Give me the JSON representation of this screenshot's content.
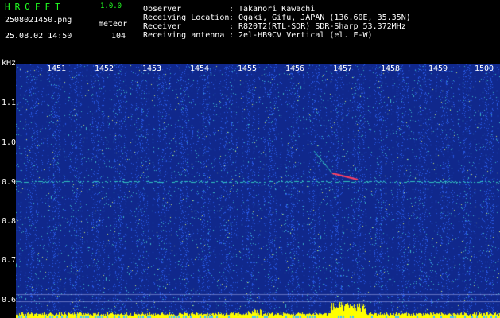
{
  "app": {
    "name": "HROFFT",
    "version": "1.0.0"
  },
  "file": {
    "name": "2508021450.png",
    "datetime": "25.08.02 14:50"
  },
  "meteor": {
    "label": "meteor",
    "count": "104"
  },
  "station": {
    "rows": [
      {
        "label": "Observer",
        "value": "Takanori Kawachi"
      },
      {
        "label": "Receiving Location",
        "value": "Ogaki, Gifu, JAPAN (136.60E, 35.35N)"
      },
      {
        "label": "Receiver",
        "value": "R820T2(RTL-SDR) SDR-Sharp 53.372MHz"
      },
      {
        "label": "Receiving antenna",
        "value": "2el-HB9CV Vertical (el. E-W)"
      }
    ]
  },
  "spectrogram": {
    "unit": "kHz",
    "y_ticks": [
      "1.1",
      "1.0",
      "0.9",
      "0.8",
      "0.7",
      "0.6"
    ],
    "x_ticks": [
      "1451",
      "1452",
      "1453",
      "1454",
      "1455",
      "1456",
      "1457",
      "1458",
      "1459",
      "1500"
    ],
    "colors": {
      "background": "#10288c",
      "noise": "#2050d8",
      "signal": "#30c0c0",
      "echo": "#ff4060",
      "bar": "#ffff00"
    }
  }
}
